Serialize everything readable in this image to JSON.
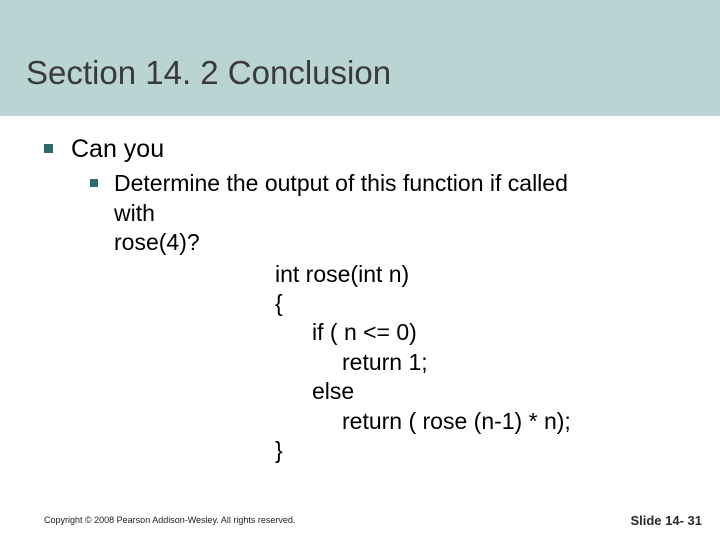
{
  "title": "Section 14. 2 Conclusion",
  "bullets": {
    "l1": "Can you",
    "l2_line1": "Determine the output of this function if called",
    "l2_line2": "with",
    "l2_line3": "rose(4)?"
  },
  "code": {
    "c0": "int rose(int n)",
    "c1": "{",
    "c2": "if ( n <= 0)",
    "c3": "return 1;",
    "c4": "else",
    "c5": "return ( rose (n-1) * n);",
    "c6": "}"
  },
  "footer": {
    "copyright": "Copyright © 2008 Pearson Addison-Wesley.  All rights reserved.",
    "slide": "Slide 14- 31"
  }
}
